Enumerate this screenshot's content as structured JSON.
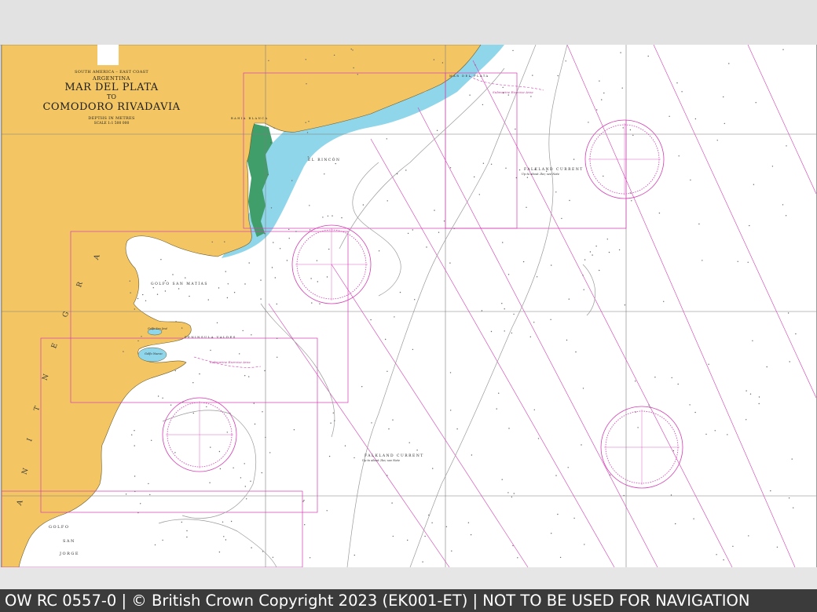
{
  "chart": {
    "region": "SOUTH AMERICA – EAST COAST",
    "country": "ARGENTINA",
    "title_line1": "MAR DEL PLATA",
    "title_to": "TO",
    "title_line2": "COMODORO RIVADAVIA",
    "depths": "DEPTHS IN METRES",
    "scale": "SCALE 1:1 500 000"
  },
  "labels": {
    "el_rincon": "EL RINCÓN",
    "falkland_current_1": "FALKLAND CURRENT",
    "falkland_current_1_sub": "Up to about 2kn; see Note",
    "falkland_current_2": "FALKLAND CURRENT",
    "falkland_current_2_sub": "Up to about 2kn; see Note",
    "golfo_san_matias": "GOLFO SAN MATÍAS",
    "golfo_san_jorge_1": "GOLFO",
    "golfo_san_jorge_2": "SAN",
    "golfo_san_jorge_3": "JORGE",
    "peninsula_valdes": "PENINSULA VALDES",
    "golfo_nuevo": "Golfo Nuevo",
    "golfo_san_jose": "Golfo San José",
    "bahia_blanca": "BAHIA BLANCA",
    "mar_del_plata": "MAR DEL PLATA",
    "submarine_area_1": "Submarine Exercise Area",
    "submarine_area_2": "Submarine Exercise Area",
    "argentina_letters": [
      "A",
      "R",
      "G",
      "E",
      "N",
      "T",
      "I",
      "N",
      "A"
    ]
  },
  "footer": {
    "text": "OW RC 0557-0 | © British Crown Copyright 2023 (EK001-ET) | NOT TO BE USED FOR NAVIGATION"
  },
  "colors": {
    "land": "#f3c663",
    "shallow_water": "#8fd6ea",
    "deep_water": "#ffffff",
    "intertidal": "#3f9e6a",
    "magenta": "#d43cb4",
    "grid": "#7d7d7d",
    "contour": "#9a9a9a"
  }
}
